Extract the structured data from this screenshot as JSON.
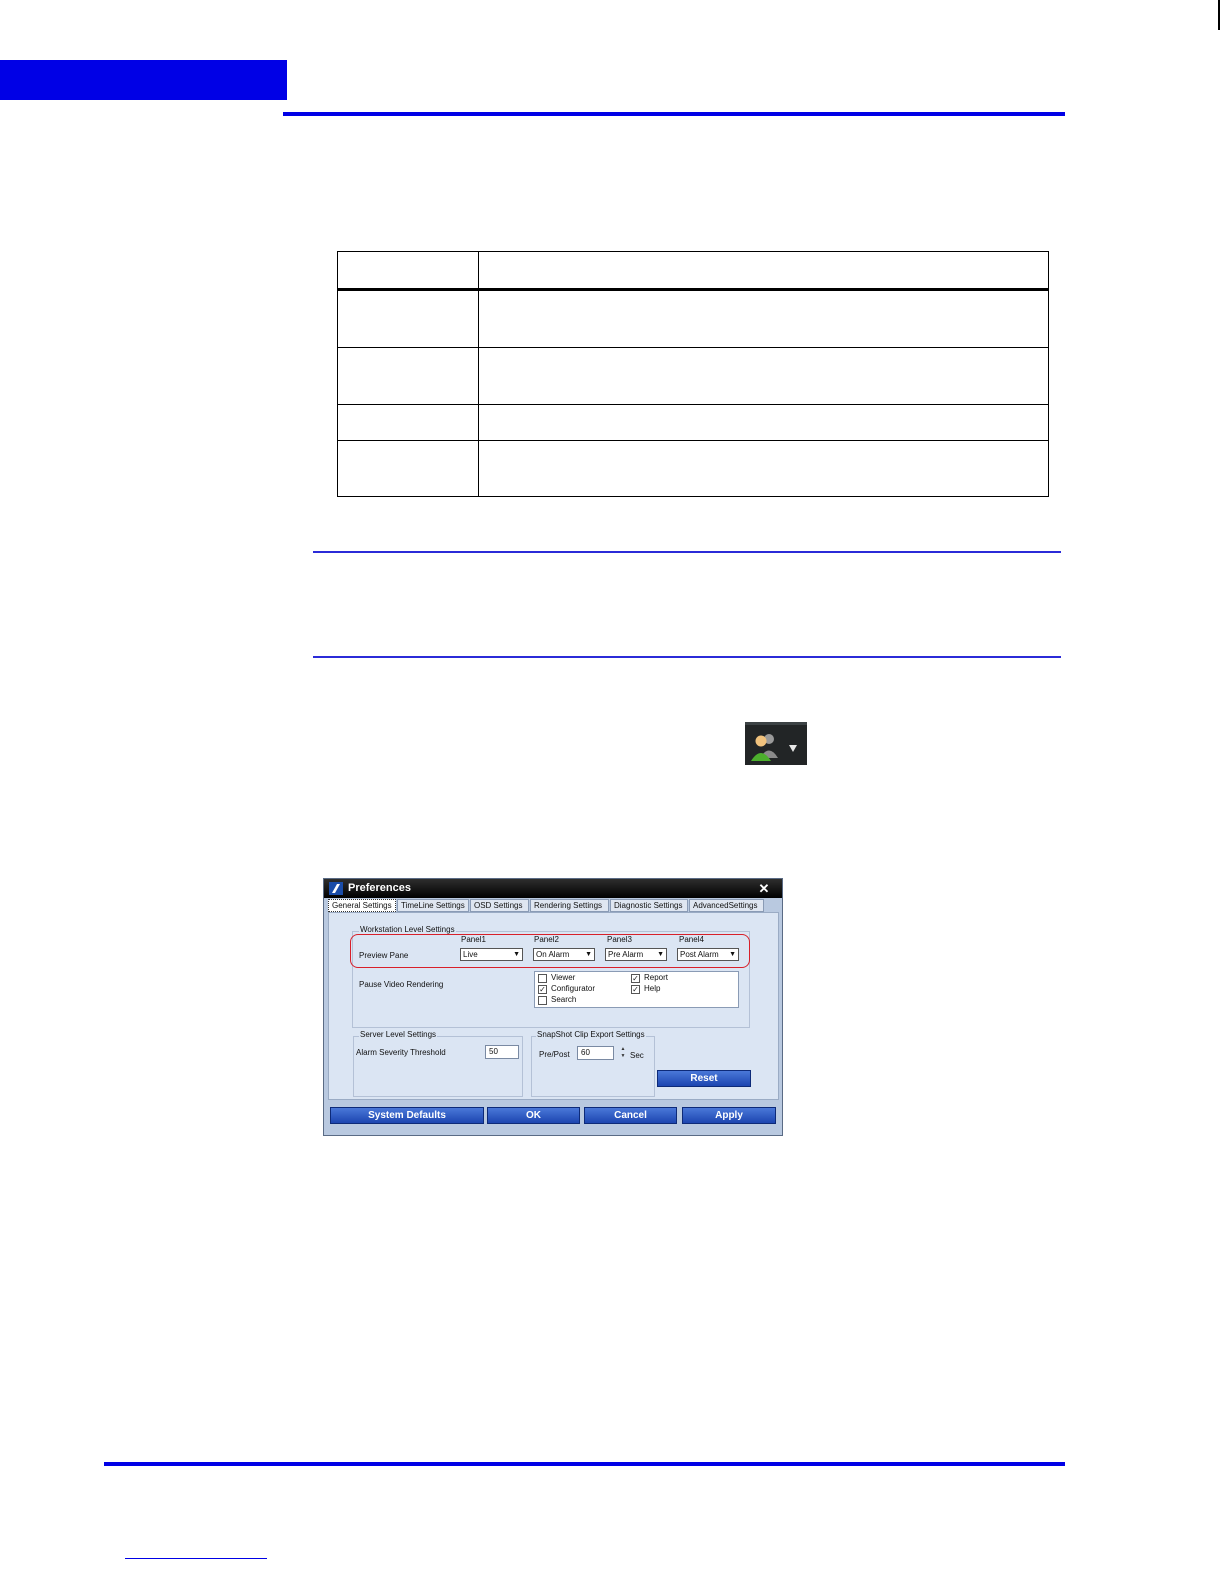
{
  "dialog": {
    "title": "Preferences",
    "close_glyph": "✕",
    "tabs": [
      "General Settings",
      "TimeLine Settings",
      "OSD Settings",
      "Rendering Settings",
      "Diagnostic Settings",
      "AdvancedSettings"
    ],
    "workstation": {
      "group_label": "Workstation Level Settings",
      "panel_labels": [
        "Panel1",
        "Panel2",
        "Panel3",
        "Panel4"
      ],
      "preview_label": "Preview Pane",
      "preview_values": [
        "Live",
        "On Alarm",
        "Pre Alarm",
        "Post Alarm"
      ],
      "pause_label": "Pause Video Rendering",
      "checkboxes": [
        {
          "label": "Viewer",
          "checked": false
        },
        {
          "label": "Configurator",
          "checked": true
        },
        {
          "label": "Search",
          "checked": false
        },
        {
          "label": "Report",
          "checked": true
        },
        {
          "label": "Help",
          "checked": true
        }
      ]
    },
    "server": {
      "group_label": "Server Level Settings",
      "threshold_label": "Alarm Severity Threshold",
      "threshold_value": "50"
    },
    "snapshot": {
      "group_label": "SnapShot Clip Export Settings",
      "prepost_label": "Pre/Post",
      "prepost_value": "60",
      "unit": "Sec"
    },
    "buttons": {
      "reset": "Reset",
      "system_defaults": "System Defaults",
      "ok": "OK",
      "cancel": "Cancel",
      "apply": "Apply"
    }
  },
  "colors": {
    "accent_blue": "#0000e6",
    "highlight_red": "#d8202a",
    "dialog_button": "#2a55c0"
  },
  "icons": {
    "toolbar": "users-icon",
    "app_logo": "app-logo-icon"
  }
}
